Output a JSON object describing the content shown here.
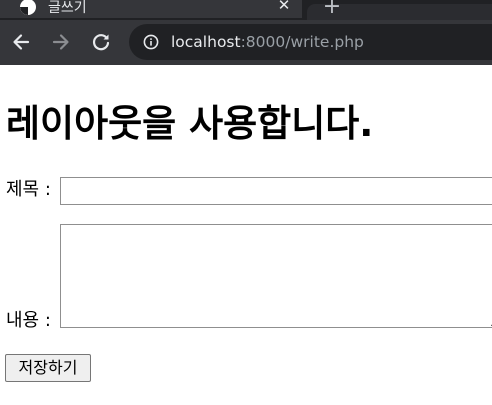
{
  "browser": {
    "tab_title": "글쓰기",
    "close_glyph": "✕",
    "new_tab_glyph": "+",
    "url_host": "localhost",
    "url_rest": ":8000/write.php",
    "icons": {
      "back": "arrow-left-icon",
      "forward": "arrow-right-icon",
      "reload": "reload-icon",
      "site_info": "info-icon"
    },
    "colors": {
      "tabstrip": "#202124",
      "toolbar": "#35363a",
      "omnibox": "#202124"
    }
  },
  "page": {
    "heading": "레이아웃을 사용합니다.",
    "form": {
      "title_label": "제목 :",
      "title_value": "",
      "content_label": "내용 :",
      "content_value": "",
      "submit_label": "저장하기"
    }
  }
}
